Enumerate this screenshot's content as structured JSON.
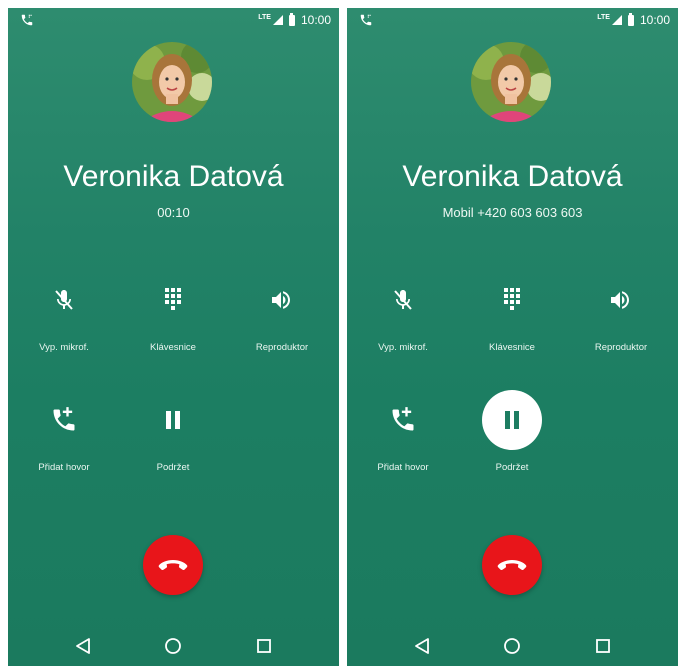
{
  "status": {
    "network": "LTE",
    "time": "10:00"
  },
  "screens": [
    {
      "contact_name": "Veronika Datová",
      "subline": "00:10",
      "buttons": {
        "mute": "Vyp. mikrof.",
        "keypad": "Klávesnice",
        "speaker": "Reproduktor",
        "add_call": "Přidat hovor",
        "hold": "Podržet"
      }
    },
    {
      "contact_name": "Veronika Datová",
      "subline": "Mobil +420 603 603 603",
      "buttons": {
        "mute": "Vyp. mikrof.",
        "keypad": "Klávesnice",
        "speaker": "Reproduktor",
        "add_call": "Přidat hovor",
        "hold": "Podržet"
      }
    }
  ],
  "colors": {
    "background": "#1f8063",
    "end_call": "#e8151a",
    "hold_active": "#ffffff"
  },
  "icons": [
    "phone-call-icon",
    "signal-icon",
    "battery-icon",
    "mic-off-icon",
    "dialpad-icon",
    "volume-icon",
    "add-call-icon",
    "pause-icon",
    "end-call-icon",
    "back-icon",
    "home-icon",
    "recents-icon"
  ]
}
